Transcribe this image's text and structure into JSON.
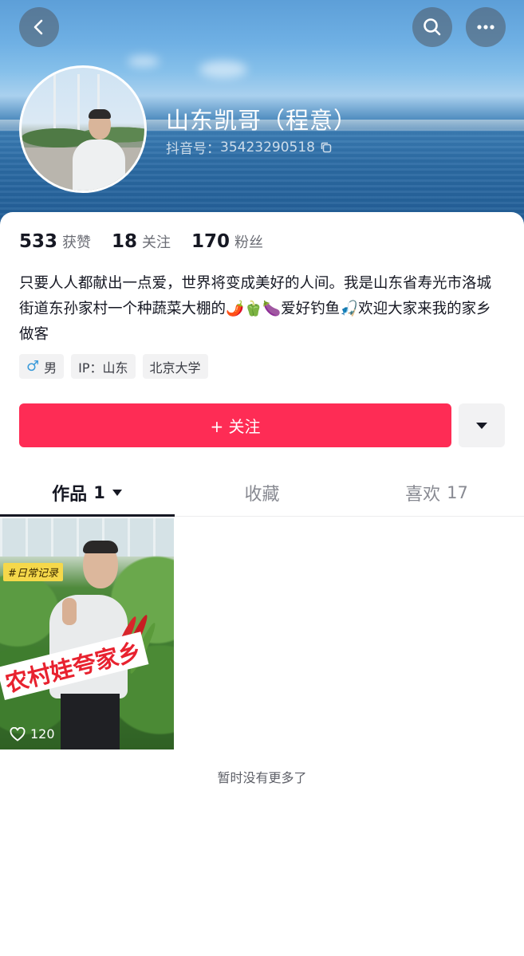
{
  "header": {
    "back_icon": "chevron-left-icon",
    "search_icon": "search-icon",
    "more_icon": "ellipsis-icon"
  },
  "profile": {
    "name": "山东凯哥（程意）",
    "douyin_id_label": "抖音号：",
    "douyin_id": "35423290518",
    "copy_icon": "copy-icon"
  },
  "stats": [
    {
      "value": "533",
      "label": "获赞"
    },
    {
      "value": "18",
      "label": "关注"
    },
    {
      "value": "170",
      "label": "粉丝"
    }
  ],
  "bio": "只要人人都献出一点爱，世界将变成美好的人间。我是山东省寿光市洛城街道东孙家村一个种蔬菜大棚的🌶️🫑🍆爱好钓鱼🎣欢迎大家来我的家乡做客",
  "tags": [
    {
      "icon": "♂",
      "text": "男"
    },
    {
      "icon": "",
      "text": "IP：山东"
    },
    {
      "icon": "",
      "text": "北京大学"
    }
  ],
  "actions": {
    "follow_label": "+ 关注",
    "more_icon": "caret-down-icon"
  },
  "tabs": [
    {
      "label": "作品",
      "count": "1",
      "has_caret": true
    },
    {
      "label": "收藏",
      "count": ""
    },
    {
      "label": "喜欢",
      "count": "17"
    }
  ],
  "videos": [
    {
      "badge": "#日常记录",
      "caption": "农村娃夸家乡",
      "likes": "120"
    }
  ],
  "footer": {
    "no_more": "暂时没有更多了"
  },
  "colors": {
    "accent": "#fe2c55",
    "text": "#161823",
    "muted": "#888a92"
  }
}
